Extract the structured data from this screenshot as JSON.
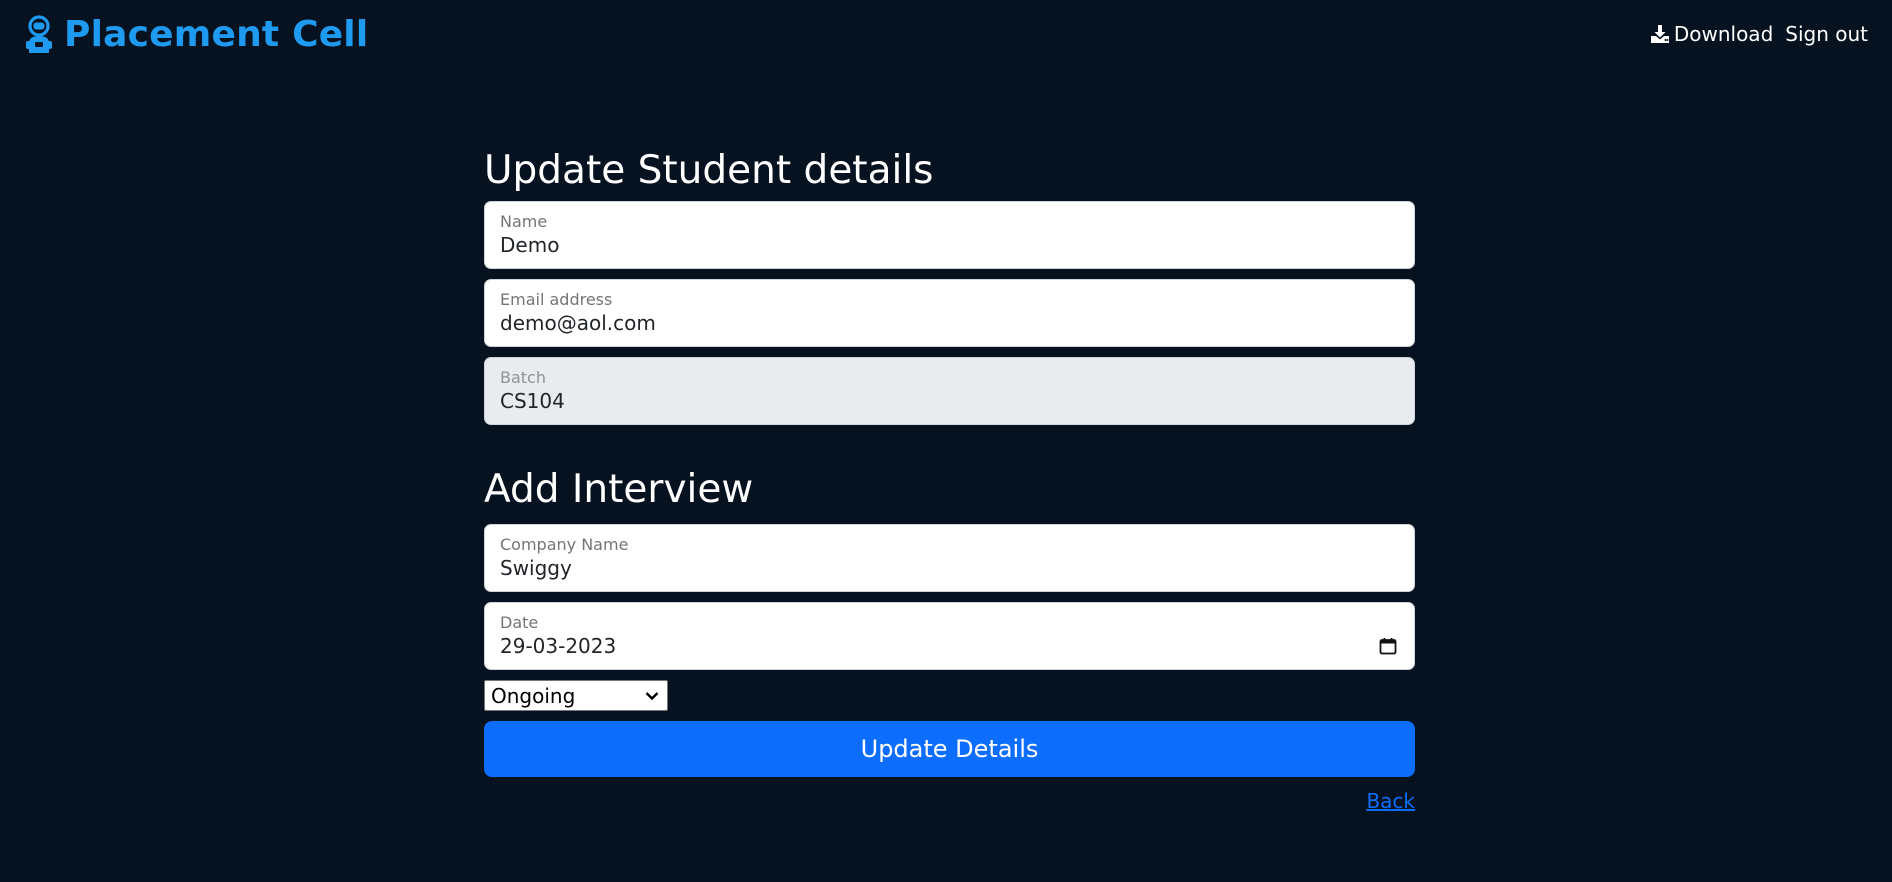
{
  "brand": {
    "name": "Placement Cell",
    "icon": "astronaut-icon",
    "color": "#1e9af0"
  },
  "nav": {
    "download_label": "Download",
    "download_icon": "download-icon",
    "signout_label": "Sign out"
  },
  "student_section": {
    "title": "Update Student details",
    "fields": [
      {
        "label": "Name",
        "value": "Demo"
      },
      {
        "label": "Email address",
        "value": "demo@aol.com"
      },
      {
        "label": "Batch",
        "value": "CS104",
        "disabled": true
      }
    ]
  },
  "interview_section": {
    "title": "Add Interview",
    "company": {
      "label": "Company Name",
      "value": "Swiggy"
    },
    "date": {
      "label": "Date",
      "value": "29-03-2023",
      "icon": "calendar-icon"
    },
    "status": {
      "selected": "Ongoing"
    }
  },
  "actions": {
    "submit_label": "Update Details",
    "back_label": "Back"
  },
  "colors": {
    "background": "#06121f",
    "primary": "#0d6efd",
    "disabled_field": "#e9ecef"
  }
}
